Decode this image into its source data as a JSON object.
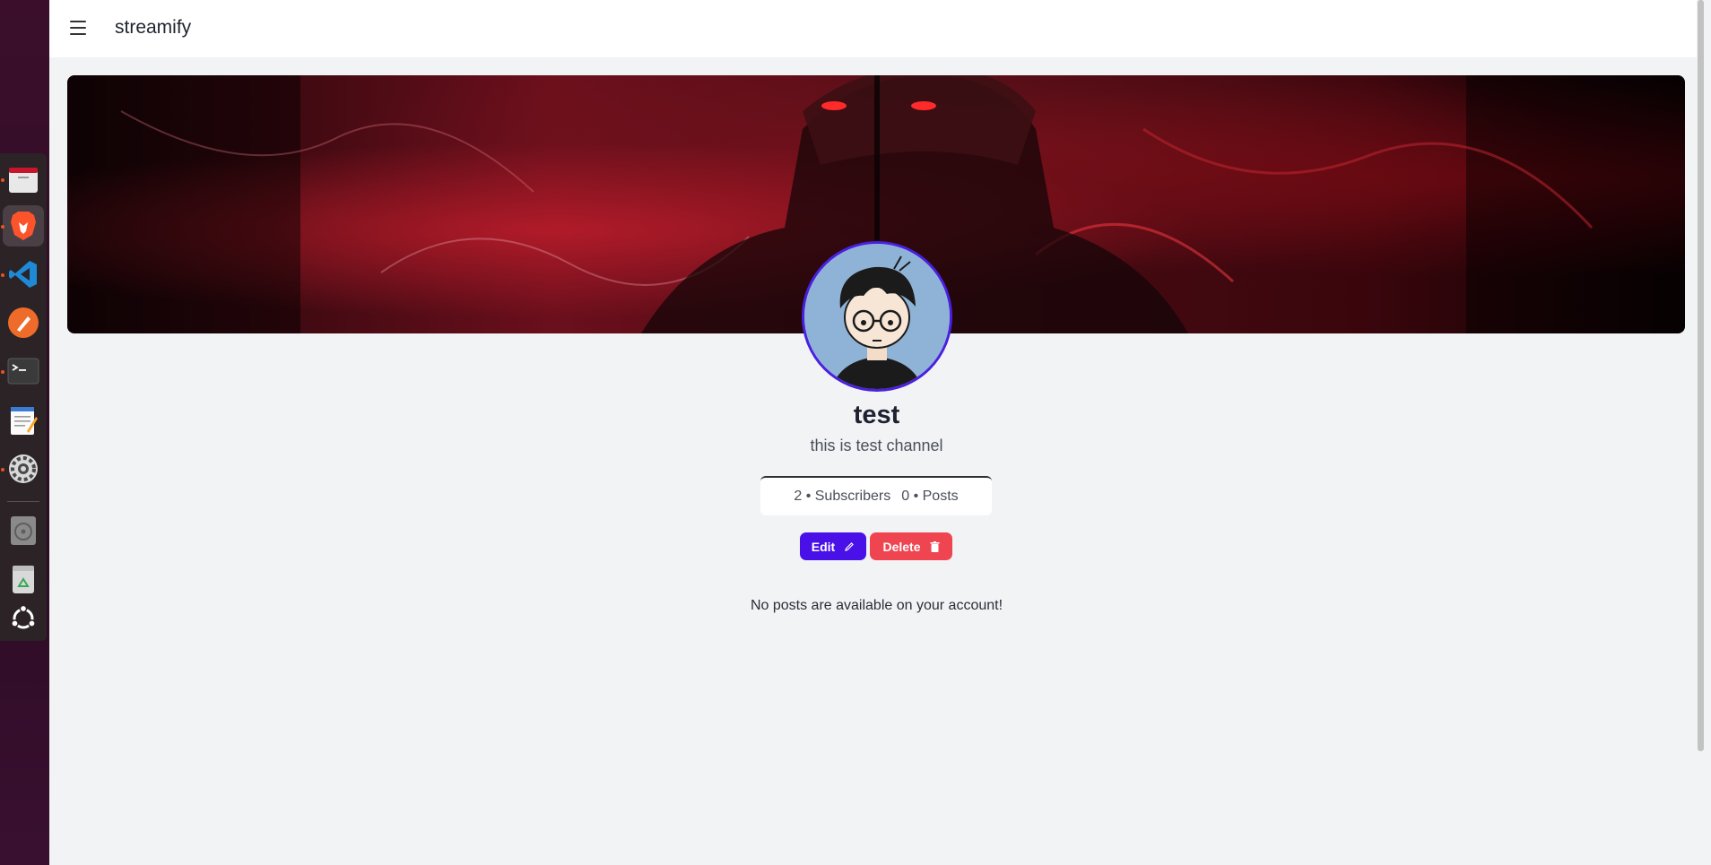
{
  "dock": {
    "apps": [
      {
        "name": "files",
        "icon": "folder-icon"
      },
      {
        "name": "brave",
        "icon": "brave-lion-icon"
      },
      {
        "name": "vscode",
        "icon": "vscode-icon"
      },
      {
        "name": "postman",
        "icon": "postman-icon"
      },
      {
        "name": "terminal",
        "icon": "terminal-icon"
      },
      {
        "name": "text-editor",
        "icon": "text-editor-icon"
      },
      {
        "name": "settings",
        "icon": "settings-gear-icon"
      },
      {
        "name": "disc",
        "icon": "optical-disc-icon"
      },
      {
        "name": "trash",
        "icon": "trash-icon"
      },
      {
        "name": "show-apps",
        "icon": "ubuntu-logo-icon"
      }
    ]
  },
  "navbar": {
    "brand": "streamify"
  },
  "profile": {
    "name": "test",
    "description": "this is test channel",
    "subscribers": "2 • Subscribers",
    "posts": "0 • Posts"
  },
  "actions": {
    "edit_label": "Edit",
    "delete_label": "Delete"
  },
  "content": {
    "empty_message": "No posts are available on your account!"
  },
  "colors": {
    "accent": "#4a10e8",
    "danger": "#ee4551",
    "background": "#f2f3f5"
  }
}
